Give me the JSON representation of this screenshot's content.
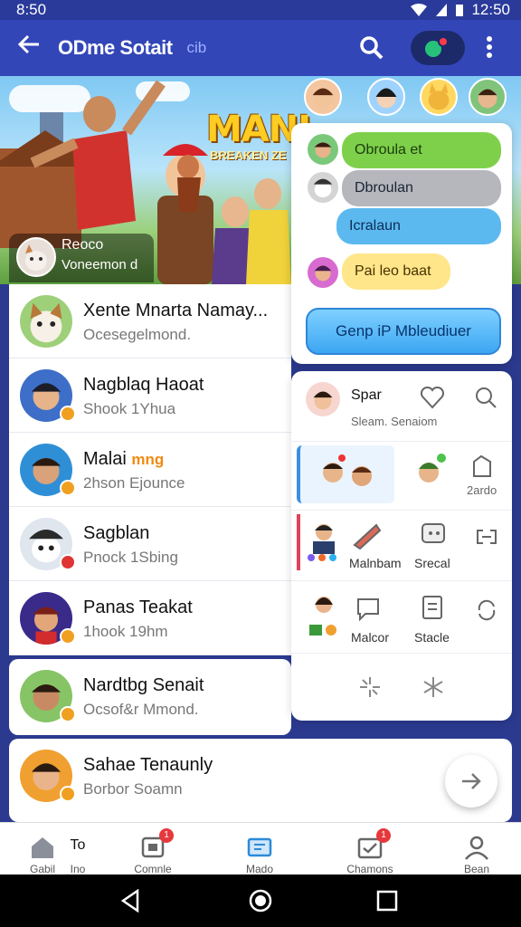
{
  "status_bar": {
    "time": "8:50",
    "clock": "12:50"
  },
  "app_bar": {
    "title": "ODme Sotait",
    "subtitle": "cib"
  },
  "banner": {
    "logo_text": "MANI",
    "logo_subtext": "BREAKEN ZE",
    "profile_name": "Reoco",
    "profile_sub": "Voneemon d"
  },
  "chats": [
    {
      "name": "Xente Mnarta Namay...",
      "message": "Ocesegelmond."
    },
    {
      "name": "Nagblaq Haoat",
      "message": "Shook 1Yhua"
    },
    {
      "name": "Malai",
      "tag": "mng",
      "message": "2hson Ejounce"
    },
    {
      "name": "Sagblan",
      "message": "Pnock 1Sbing"
    },
    {
      "name": "Panas Teakat",
      "message": "1hook 19hm"
    }
  ],
  "card2": {
    "name": "Nardtbg Senait",
    "message": "Ocsof&r Mmond."
  },
  "card3": {
    "name": "Sahae Tenaunly",
    "message": "Borbor Soamn"
  },
  "chat_panel": {
    "bubbles": [
      {
        "text": "Obroula et"
      },
      {
        "text": "Dbroulan"
      },
      {
        "text": "Icralaun"
      },
      {
        "text": "Pai leo baat"
      }
    ],
    "button_label": "Genp iP Mbleudiuer"
  },
  "grid_panel": {
    "row1": {
      "title": "Spar",
      "subtitle": "Sleam. Senaiom"
    },
    "row2": {
      "label3": "2ardo"
    },
    "row3": {
      "label2": "Malnbam",
      "label3": "Srecal"
    },
    "row4": {
      "label2": "Malcor",
      "label3": "Stacle"
    }
  },
  "bottom_nav": [
    {
      "label": "Gabil",
      "icon": "home-icon"
    },
    {
      "label": "Ino",
      "extra": "To"
    },
    {
      "label": "Comnle",
      "icon": "chat-icon",
      "badge": "1"
    },
    {
      "label": "Mado",
      "icon": "tv-icon"
    },
    {
      "label": "Chamons",
      "icon": "tasks-icon",
      "badge": "1"
    },
    {
      "label": "Bean",
      "icon": "person-icon"
    }
  ],
  "colors": {
    "primary": "#3346b8",
    "status": "#2a3a9a",
    "green": "#7ed04b",
    "blue": "#5cb9f0",
    "yellow": "#ffe68a"
  }
}
